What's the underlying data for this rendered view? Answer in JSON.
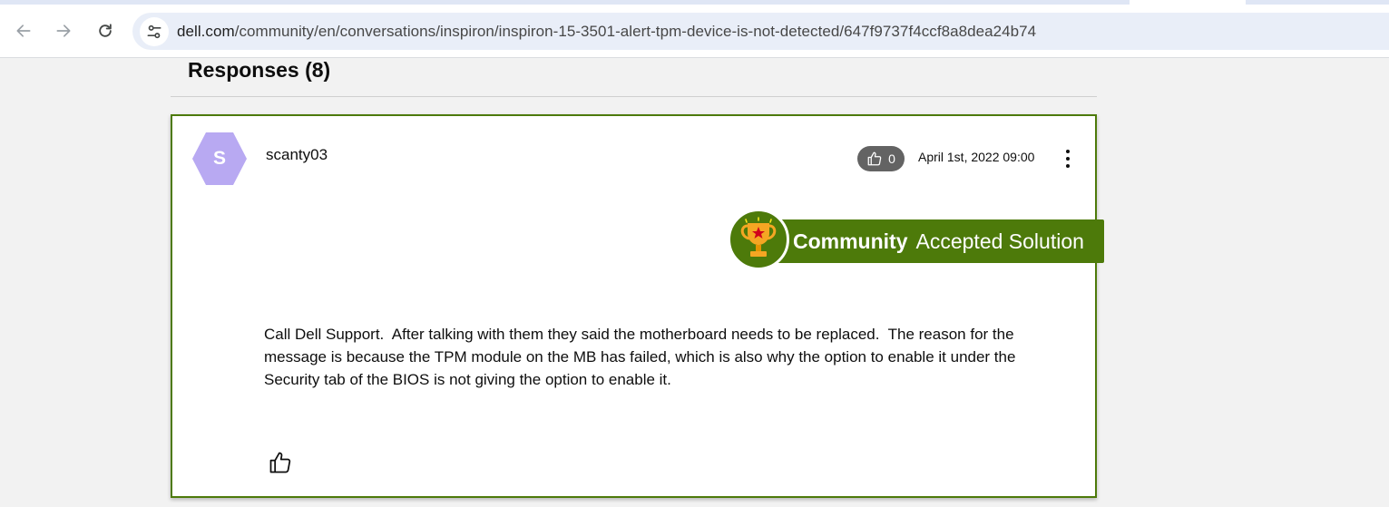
{
  "browser": {
    "url_host": "dell.com",
    "url_path": "/community/en/conversations/inspiron/inspiron-15-3501-alert-tpm-device-is-not-detected/647f9737f4ccf8a8dea24b74",
    "icons": [
      "back-arrow-icon",
      "forward-arrow-icon",
      "reload-icon",
      "site-info-icon"
    ]
  },
  "responses": {
    "title": "Responses (8)"
  },
  "post": {
    "avatar_letter": "S",
    "avatar_color": "#b8a9f2",
    "username": "scanty03",
    "kudos_count": "0",
    "date": "April 1st, 2022 09:00",
    "solution_badge": {
      "strong_label": "Community",
      "light_label": "Accepted Solution",
      "color": "#4d7a0a"
    },
    "body_lines": [
      "Call Dell Support.  After talking with them they said the motherboard needs to be replaced.  The reason for the",
      "message is because the TPM module on the MB has failed, which is also why the option to enable it under the",
      "Security tab of the BIOS is not giving the option to enable it."
    ]
  }
}
